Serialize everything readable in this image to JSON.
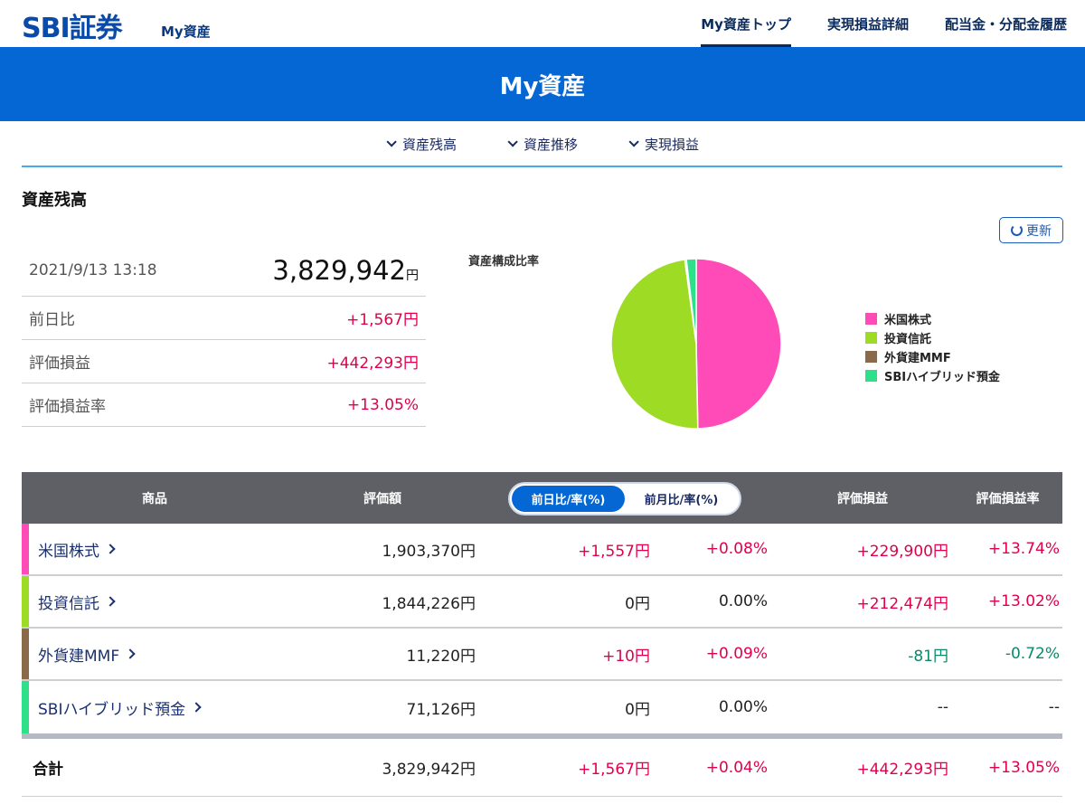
{
  "header": {
    "logo": "SBI証券",
    "logo_sub": "My資産",
    "nav": [
      "My資産トップ",
      "実現損益詳細",
      "配当金・分配金履歴"
    ]
  },
  "banner": {
    "title": "My資産"
  },
  "anchors": [
    "資産残高",
    "資産推移",
    "実現損益"
  ],
  "section": {
    "title": "資産残高",
    "refresh": "更新"
  },
  "summary": {
    "date": "2021/9/13 13:18",
    "total": "3,829,942",
    "total_unit": "円",
    "rows": [
      {
        "label": "前日比",
        "value": "+1,567円"
      },
      {
        "label": "評価損益",
        "value": "+442,293円"
      },
      {
        "label": "評価損益率",
        "value": "+13.05%"
      }
    ]
  },
  "pie": {
    "title": "資産構成比率",
    "colors": [
      "#ff4bb7",
      "#9edb24",
      "#8b6a4a",
      "#2fe08a"
    ]
  },
  "chart_data": {
    "type": "pie",
    "title": "資産構成比率",
    "categories": [
      "米国株式",
      "投資信託",
      "外貨建MMF",
      "SBIハイブリッド預金"
    ],
    "values": [
      1903370,
      1844226,
      11220,
      71126
    ]
  },
  "table": {
    "headers": {
      "product": "商品",
      "value": "評価額",
      "toggle_day": "前日比/率(%)",
      "toggle_month": "前月比/率(%)",
      "pl": "評価損益",
      "pl_rate": "評価損益率"
    },
    "rows": [
      {
        "name": "米国株式",
        "value": "1,903,370円",
        "diff": "+1,557円",
        "diff_rate": "+0.08%",
        "pl": "+229,900円",
        "pl_rate": "+13.74%",
        "color": "#ff4bb7"
      },
      {
        "name": "投資信託",
        "value": "1,844,226円",
        "diff": "0円",
        "diff_rate": "0.00%",
        "pl": "+212,474円",
        "pl_rate": "+13.02%",
        "color": "#9edb24"
      },
      {
        "name": "外貨建MMF",
        "value": "11,220円",
        "diff": "+10円",
        "diff_rate": "+0.09%",
        "pl": "-81円",
        "pl_rate": "-0.72%",
        "color": "#8b6a4a"
      },
      {
        "name": "SBIハイブリッド預金",
        "value": "71,126円",
        "diff": "0円",
        "diff_rate": "0.00%",
        "pl": "--",
        "pl_rate": "--",
        "color": "#2fe08a"
      }
    ],
    "total": {
      "label": "合計",
      "value": "3,829,942円",
      "diff": "+1,567円",
      "diff_rate": "+0.04%",
      "pl": "+442,293円",
      "pl_rate": "+13.05%"
    }
  }
}
